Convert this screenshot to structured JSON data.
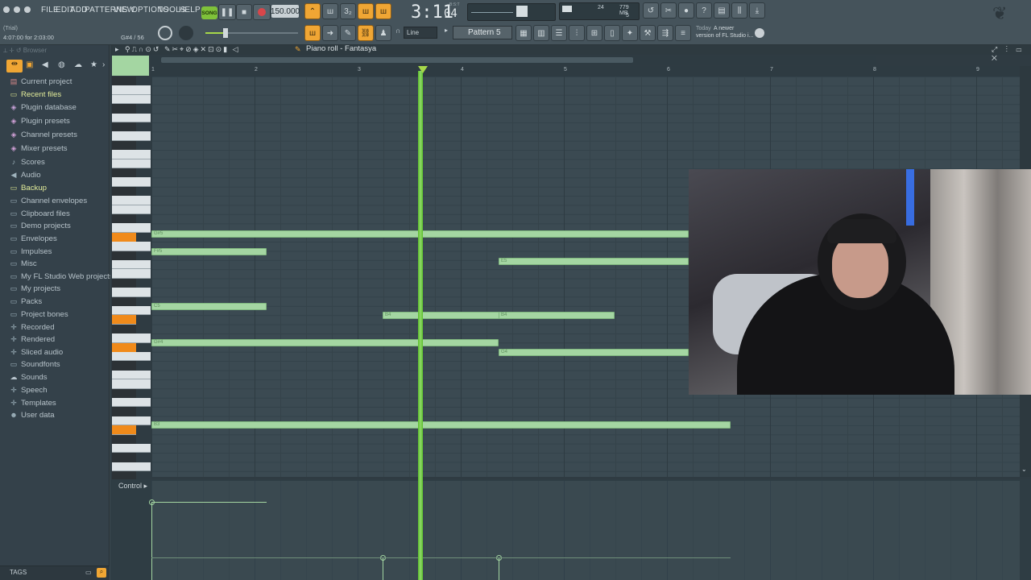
{
  "menu": [
    "FILE",
    "EDIT",
    "ADD",
    "PATTERNS",
    "VIEW",
    "OPTIONS",
    "TOOLS",
    "HELP"
  ],
  "transport": {
    "song_label": "SONG",
    "tempo": "150.000",
    "time": "3:11",
    "time_sub": "04",
    "time_unit": "B:S:T"
  },
  "monitor": {
    "cpu": "24",
    "mem": "779 MB",
    "poly": "5"
  },
  "hint": {
    "trial": "(Trial)",
    "time_info": "4:07:00 for 2:03:00",
    "note": "G#4 / 56"
  },
  "snap": "Line",
  "pattern": "Pattern 5",
  "news": {
    "line1": "Today",
    "line2": "A newer",
    "line3": "version of FL Studio i..."
  },
  "browser": {
    "title": "Browser",
    "tags": "TAGS",
    "items": [
      {
        "label": "Current project",
        "icon": "project-icon",
        "highlight": false
      },
      {
        "label": "Recent files",
        "icon": "folder-icon",
        "highlight": true
      },
      {
        "label": "Plugin database",
        "icon": "plugin-icon",
        "highlight": false
      },
      {
        "label": "Plugin presets",
        "icon": "preset-icon",
        "highlight": false
      },
      {
        "label": "Channel presets",
        "icon": "preset-icon",
        "highlight": false
      },
      {
        "label": "Mixer presets",
        "icon": "preset-icon",
        "highlight": false
      },
      {
        "label": "Scores",
        "icon": "note-icon",
        "highlight": false
      },
      {
        "label": "Audio",
        "icon": "audio-icon",
        "highlight": false
      },
      {
        "label": "Backup",
        "icon": "folder-icon",
        "highlight": true
      },
      {
        "label": "Channel envelopes",
        "icon": "folder-icon",
        "highlight": false
      },
      {
        "label": "Clipboard files",
        "icon": "folder-icon",
        "highlight": false
      },
      {
        "label": "Demo projects",
        "icon": "folder-icon",
        "highlight": false
      },
      {
        "label": "Envelopes",
        "icon": "folder-icon",
        "highlight": false
      },
      {
        "label": "Impulses",
        "icon": "folder-icon",
        "highlight": false
      },
      {
        "label": "Misc",
        "icon": "folder-icon",
        "highlight": false
      },
      {
        "label": "My FL Studio Web projects",
        "icon": "folder-icon",
        "highlight": false
      },
      {
        "label": "My projects",
        "icon": "folder-icon",
        "highlight": false
      },
      {
        "label": "Packs",
        "icon": "folder-icon",
        "highlight": false
      },
      {
        "label": "Project bones",
        "icon": "folder-icon",
        "highlight": false
      },
      {
        "label": "Recorded",
        "icon": "plus-icon",
        "highlight": false
      },
      {
        "label": "Rendered",
        "icon": "plus-icon",
        "highlight": false
      },
      {
        "label": "Sliced audio",
        "icon": "plus-icon",
        "highlight": false
      },
      {
        "label": "Soundfonts",
        "icon": "folder-icon",
        "highlight": false
      },
      {
        "label": "Sounds",
        "icon": "cloud-icon",
        "highlight": false
      },
      {
        "label": "Speech",
        "icon": "plus-icon",
        "highlight": false
      },
      {
        "label": "Templates",
        "icon": "plus-icon",
        "highlight": false
      },
      {
        "label": "User data",
        "icon": "user-icon",
        "highlight": false
      }
    ]
  },
  "pianoroll": {
    "title": "Piano roll - Fantasya",
    "bars": [
      "1",
      "2",
      "3",
      "4",
      "5",
      "6",
      "7",
      "8",
      "9"
    ],
    "control_label": "Control"
  },
  "notes": [
    {
      "label": "G#5"
    },
    {
      "label": "F#5"
    },
    {
      "label": "E5"
    },
    {
      "label": "C5"
    },
    {
      "label": "B4"
    },
    {
      "label": "B4"
    },
    {
      "label": "G#4"
    },
    {
      "label": "G4"
    },
    {
      "label": "B3"
    }
  ]
}
